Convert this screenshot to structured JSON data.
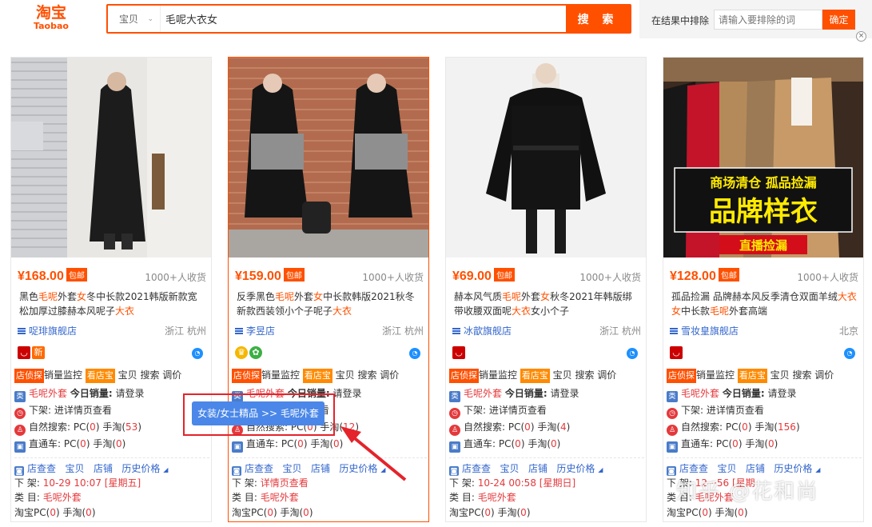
{
  "header": {
    "logo_cn": "淘宝",
    "logo_en": "Taobao",
    "category": "宝贝",
    "query": "毛呢大衣女",
    "search_label": "搜 索",
    "exclude_label": "在结果中排除",
    "exclude_placeholder": "请输入要排除的词",
    "exclude_button": "确定",
    "close": "×"
  },
  "popup": {
    "text": "女装/女士精品 >> 毛呢外套"
  },
  "watermark": "知乎 @花和尚",
  "labels": {
    "baoyou": "包邮",
    "tag_shop": "店侦探",
    "sales_monitor": "销量监控",
    "tag_kan": "看店宝",
    "item_rest": "宝贝 搜索 调价",
    "cat_badge": "类",
    "today_sales": "今日销量:",
    "login": "请登录",
    "offline_label": "下架:",
    "natural_search": "自然搜索: PC",
    "handtao": "手淘",
    "zhitongche": "直通车: PC",
    "foot_links": [
      "店查查",
      "宝贝",
      "店铺",
      "历史价格"
    ],
    "foot_xiajia": "下 架:",
    "foot_leimu": "类 目:",
    "foot_tb": "淘宝PC",
    "foot_sh": "手淘",
    "open_paren": "(",
    "close_paren": ")",
    "new_badge": "新"
  },
  "products": [
    {
      "price": "¥168.00",
      "sold": "1000+人收货",
      "title_parts": [
        [
          "黑色",
          0
        ],
        [
          "毛呢",
          1
        ],
        [
          "外套",
          0
        ],
        [
          "女",
          1
        ],
        [
          "冬中长款2021韩版新款宽松加厚过膝赫本风呢子",
          0
        ],
        [
          "大衣",
          1
        ]
      ],
      "shop": "哫琲旗舰店",
      "location": "浙江 杭州",
      "category": "毛呢外套",
      "offline": "进详情页查看",
      "nat_pc": "0",
      "nat_sh": "53",
      "ztc_pc": "0",
      "ztc_sh": "0",
      "foot_offline": "10-29 10:07 [星期五]",
      "foot_cat": "毛呢外套",
      "foot_pc": "0",
      "foot_sh": "0"
    },
    {
      "price": "¥159.00",
      "sold": "1000+人收货",
      "title_parts": [
        [
          "反季黑色",
          0
        ],
        [
          "毛呢",
          1
        ],
        [
          "外套",
          0
        ],
        [
          "女",
          1
        ],
        [
          "中长款韩版2021秋冬新款西装领小个子呢子",
          0
        ],
        [
          "大衣",
          1
        ]
      ],
      "shop": "李昱店",
      "location": "浙江 杭州",
      "category": "毛呢外套",
      "offline": "进详情页查看",
      "nat_pc": "0",
      "nat_sh": "12",
      "ztc_pc": "0",
      "ztc_sh": "0",
      "foot_offline": "详情页查看",
      "foot_cat": "毛呢外套",
      "foot_pc": "0",
      "foot_sh": "0"
    },
    {
      "price": "¥69.00",
      "sold": "1000+人收货",
      "title_parts": [
        [
          "赫本风气质",
          0
        ],
        [
          "毛呢",
          1
        ],
        [
          "外套",
          0
        ],
        [
          "女",
          1
        ],
        [
          "秋冬2021年韩版绑带收腰双面呢",
          0
        ],
        [
          "大衣",
          1
        ],
        [
          "女小个子",
          0
        ]
      ],
      "shop": "冰歆旗舰店",
      "location": "浙江 杭州",
      "category": "毛呢外套",
      "offline": "进详情页查看",
      "nat_pc": "0",
      "nat_sh": "4",
      "ztc_pc": "0",
      "ztc_sh": "0",
      "foot_offline": "10-24 00:58 [星期日]",
      "foot_cat": "毛呢外套",
      "foot_pc": "0",
      "foot_sh": "0"
    },
    {
      "price": "¥128.00",
      "sold": "1000+人收货",
      "title_parts": [
        [
          "孤品捡漏 品牌赫本风反季清仓双面羊绒",
          0
        ],
        [
          "大衣",
          1
        ],
        [
          "女",
          1
        ],
        [
          "中长款",
          0
        ],
        [
          "毛呢",
          1
        ],
        [
          "外套高端",
          0
        ]
      ],
      "shop": "雪妆皇旗舰店",
      "location": "北京",
      "category": "毛呢外套",
      "offline": "进详情页查看",
      "nat_pc": "0",
      "nat_sh": "156",
      "ztc_pc": "0",
      "ztc_sh": "0",
      "foot_offline": "12-··56 [星期",
      "foot_cat": "毛呢外套",
      "foot_pc": "0",
      "foot_sh": "0"
    }
  ],
  "promo": {
    "line1": "商场清仓 孤品捡漏",
    "line2": "品牌样衣",
    "line3": "直播捡漏"
  },
  "colors": {
    "accent": "#ff5000",
    "link": "#3366cc",
    "red": "#e4393c"
  }
}
